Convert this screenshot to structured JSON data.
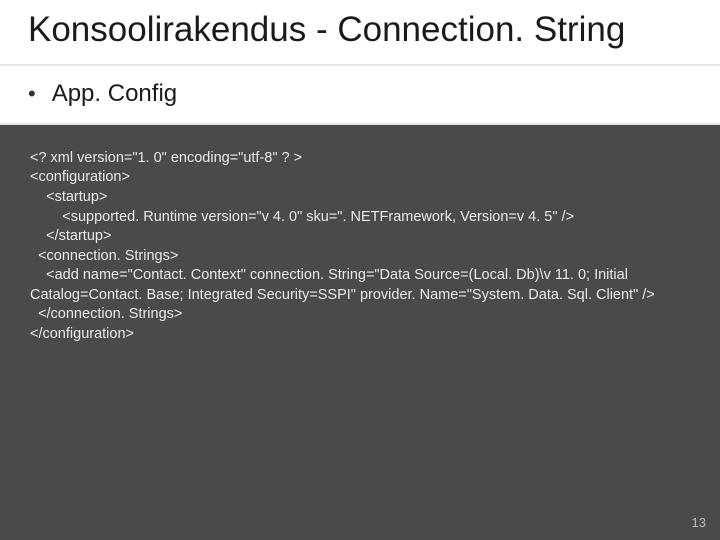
{
  "title": "Konsoolirakendus - Connection. String",
  "bullet": {
    "dot": "•",
    "text": "App. Config"
  },
  "code": "<? xml version=\"1. 0\" encoding=\"utf-8\" ? >\n<configuration>\n    <startup>\n        <supported. Runtime version=\"v 4. 0\" sku=\". NETFramework, Version=v 4. 5\" />\n    </startup>\n  <connection. Strings>\n    <add name=\"Contact. Context\" connection. String=\"Data Source=(Local. Db)\\v 11. 0; Initial Catalog=Contact. Base; Integrated Security=SSPI\" provider. Name=\"System. Data. Sql. Client\" />\n  </connection. Strings>\n</configuration>",
  "slideNumber": "13"
}
